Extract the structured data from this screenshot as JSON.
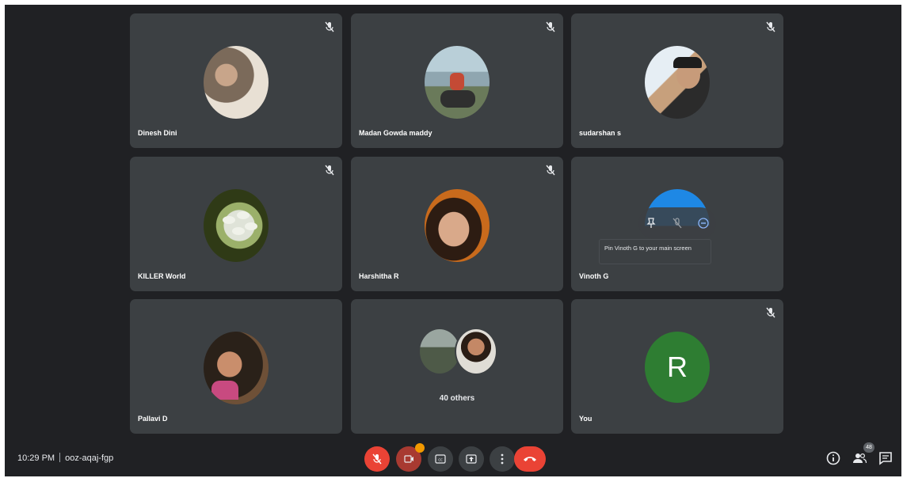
{
  "meeting": {
    "time": "10:29 PM",
    "code": "ooz-aqaj-fgp"
  },
  "participants": [
    {
      "name": "Dinesh Dini",
      "muted": true,
      "avatar_palette": [
        "#7b6a5a",
        "#c8a58a",
        "#e8e0d4"
      ]
    },
    {
      "name": "Madan Gowda maddy",
      "muted": true,
      "avatar_palette": [
        "#8fa6b0",
        "#c44a35",
        "#4f6b3a"
      ]
    },
    {
      "name": "sudarshan s",
      "muted": true,
      "avatar_palette": [
        "#d9e6ef",
        "#2b2b2b",
        "#c79b7a"
      ]
    },
    {
      "name": "KILLER World",
      "muted": true,
      "avatar_palette": [
        "#2f3a16",
        "#dfe3d8",
        "#9bb06a"
      ]
    },
    {
      "name": "Harshitha R",
      "muted": true,
      "avatar_palette": [
        "#c86a1c",
        "#d9a98a",
        "#2d1c12"
      ]
    },
    {
      "name": "Vinoth G",
      "muted": false,
      "avatar_palette": [
        "#1e88e5",
        "#64b5f6"
      ]
    },
    {
      "name": "Pallavi D",
      "muted": false,
      "avatar_palette": [
        "#2a2119",
        "#c98e6c",
        "#c84a80"
      ]
    },
    {
      "name": "You",
      "muted": true,
      "initial": "R",
      "avatar_color": "#2e7d32"
    }
  ],
  "others_tile": {
    "label": "40 others"
  },
  "tooltip": {
    "text": "Pin Vinoth G to your main screen"
  },
  "controls": {
    "mic": {
      "icon": "mic-off-icon",
      "color": "#ea4335"
    },
    "camera": {
      "icon": "camera-off-icon",
      "color": "#ea4335",
      "alert_color": "#f29900"
    },
    "captions": {
      "icon": "captions-icon"
    },
    "present": {
      "icon": "present-screen-icon"
    },
    "more": {
      "icon": "more-options-icon"
    },
    "leave": {
      "icon": "end-call-icon",
      "color": "#ea4335"
    }
  },
  "right_controls": {
    "info": {
      "icon": "info-icon"
    },
    "people": {
      "icon": "people-icon",
      "count": "48"
    },
    "chat": {
      "icon": "chat-icon"
    }
  },
  "colors": {
    "background": "#202124",
    "tile": "#3c4043",
    "danger": "#ea4335",
    "control": "#3c4043"
  }
}
